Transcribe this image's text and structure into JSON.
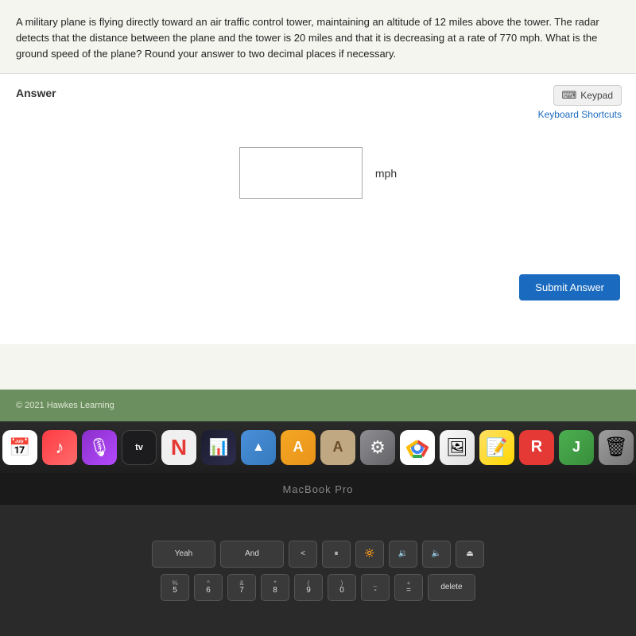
{
  "problem": {
    "text": "A military plane is flying directly toward an air traffic control tower, maintaining an altitude of 12 miles above the tower. The radar detects that the distance between the plane and the tower is 20 miles and that it is decreasing at a rate of 770 mph. What is the ground speed of the plane? Round your answer to two decimal places if necessary."
  },
  "answer_section": {
    "label": "Answer",
    "keypad_button": "Keypad",
    "keyboard_shortcuts": "Keyboard Shortcuts",
    "input_placeholder": "",
    "unit": "mph",
    "submit_button": "Submit Answer"
  },
  "footer": {
    "copyright": "© 2021 Hawkes Learning"
  },
  "macbook": {
    "label": "MacBook Pro"
  },
  "dock": {
    "icons": [
      {
        "name": "calendar",
        "symbol": "📅",
        "css_class": "red-calendar"
      },
      {
        "name": "music",
        "symbol": "♪",
        "css_class": "music"
      },
      {
        "name": "podcasts",
        "symbol": "🎙",
        "css_class": "podcasts"
      },
      {
        "name": "apple-tv",
        "symbol": "tv",
        "css_class": "apple-tv"
      },
      {
        "name": "news",
        "symbol": "N",
        "css_class": "news"
      },
      {
        "name": "stocks",
        "symbol": "📈",
        "css_class": "stocks"
      },
      {
        "name": "keynote",
        "symbol": "▲",
        "css_class": "keynote"
      },
      {
        "name": "pages",
        "symbol": "A",
        "css_class": "pages"
      },
      {
        "name": "script",
        "symbol": "A",
        "css_class": "script"
      },
      {
        "name": "settings",
        "symbol": "⚙",
        "css_class": "settings"
      },
      {
        "name": "chrome",
        "symbol": "◎",
        "css_class": "chrome"
      },
      {
        "name": "photos",
        "symbol": "🖼",
        "css_class": "photos"
      },
      {
        "name": "stickies",
        "symbol": "📝",
        "css_class": "stickies"
      },
      {
        "name": "roblox",
        "symbol": "R",
        "css_class": "roblox"
      },
      {
        "name": "java",
        "symbol": "J",
        "css_class": "javaapp"
      },
      {
        "name": "trash",
        "symbol": "🗑",
        "css_class": "trash"
      }
    ]
  },
  "keyboard": {
    "row1": [
      {
        "top": "",
        "bottom": "Yeah"
      },
      {
        "top": "",
        "bottom": "And"
      },
      {
        "top": "<",
        "bottom": ""
      },
      {
        "top": "",
        "bottom": "⏸"
      },
      {
        "top": "🔆",
        "bottom": ""
      },
      {
        "top": "🔉",
        "bottom": ""
      },
      {
        "top": "🔈",
        "bottom": ""
      },
      {
        "top": "⏏",
        "bottom": ""
      }
    ],
    "row2": [
      {
        "top": "%",
        "bottom": "5"
      },
      {
        "top": "^",
        "bottom": "6"
      },
      {
        "top": "&",
        "bottom": "7"
      },
      {
        "top": "*",
        "bottom": "8"
      },
      {
        "top": "(",
        "bottom": "9"
      },
      {
        "top": ")",
        "bottom": "0"
      },
      {
        "top": "_",
        "bottom": "-"
      },
      {
        "top": "+",
        "bottom": "="
      },
      {
        "top": "",
        "bottom": "delete",
        "wide": true
      }
    ]
  },
  "colors": {
    "submit_btn_bg": "#1a6bbf",
    "footer_bg": "#6b8f5e",
    "keyboard_shortcuts_color": "#1a6bbf"
  }
}
